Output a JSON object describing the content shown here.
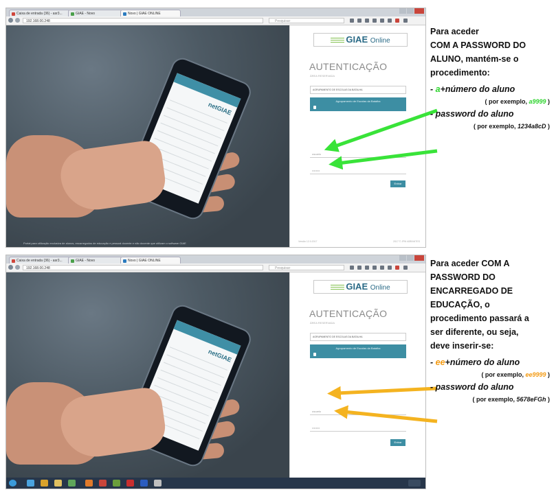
{
  "browser": {
    "tabs": [
      "Caixa de entrada (36) - asr3...",
      "GIAE - Novo",
      "Novo | GIAE ONLINE"
    ],
    "url": "192.168.00.248",
    "search_placeholder": "Pesquisar"
  },
  "giae": {
    "logo_main": "GIAE",
    "logo_suffix": "Online",
    "heading": "AUTENTICAÇÃO",
    "area_label": "ÁREA RESERVADA",
    "school_select": "AGRUPAMENTO DE ESCOLAS DA BATALHA",
    "school_button": "Agrupamento de Escolas da Batalha",
    "user_placeholder": "usuario",
    "password_placeholder": "••••••••",
    "login_button": "Entrar",
    "version": "Versão 12.0.2017",
    "copyright": "2017 © JPM ABRANTES",
    "footer_note": "Portal para utilização exclusiva de alunos, encarregados de educação e pessoal docente e não docente que utilizam o software GIAE"
  },
  "phone_screen": {
    "logo": "netGIAE"
  },
  "note_top": {
    "lines": [
      "Para aceder",
      "COM A PASSWORD DO",
      "ALUNO, mantém-se o",
      "procedimento:"
    ],
    "item1_prefix": "- ",
    "item1_code": "a",
    "item1_rest": "+número do aluno",
    "example1_pre": "( por exemplo, ",
    "example1_val": "a9999",
    "example1_post": " )",
    "item2": "- password do aluno",
    "example2_pre": "( por exemplo, ",
    "example2_val": "1234a8cD",
    "example2_post": " )"
  },
  "note_bottom": {
    "lines": [
      "Para aceder COM A",
      "PASSWORD DO",
      "ENCARREGADO DE",
      "EDUCAÇÃO, o",
      "procedimento passará a",
      "ser diferente, ou seja,",
      "deve inserir-se:"
    ],
    "item1_prefix": "- ",
    "item1_code": "ee",
    "item1_rest": "+número do aluno",
    "example1_pre": "( por exemplo, ",
    "example1_val": "ee9999",
    "example1_post": " )",
    "item2": "- password do aluno",
    "example2_pre": "( por exemplo, ",
    "example2_val": "5678eFGh",
    "example2_post": " )"
  },
  "colors": {
    "green_arrow": "#39e339",
    "orange_arrow": "#f4b320",
    "giae_teal": "#3d8ea3"
  }
}
